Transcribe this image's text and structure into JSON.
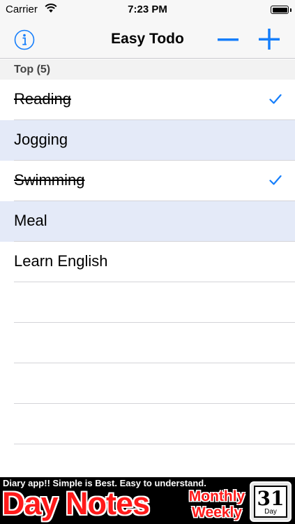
{
  "status_bar": {
    "carrier": "Carrier",
    "time": "7:23 PM"
  },
  "nav": {
    "title": "Easy Todo"
  },
  "section": {
    "header": "Top (5)"
  },
  "todos": [
    {
      "label": "Reading",
      "done": true,
      "checked": true,
      "highlighted": false
    },
    {
      "label": "Jogging",
      "done": false,
      "checked": false,
      "highlighted": true
    },
    {
      "label": "Swimming",
      "done": true,
      "checked": true,
      "highlighted": false
    },
    {
      "label": "Meal",
      "done": false,
      "checked": false,
      "highlighted": true
    },
    {
      "label": "Learn English",
      "done": false,
      "checked": false,
      "highlighted": false
    }
  ],
  "ad": {
    "tagline": "Diary app!! Simple is Best. Easy to understand.",
    "title": "Day Notes",
    "sub_line1": "Monthly",
    "sub_line2": "Weekly",
    "calendar_number": "31",
    "calendar_label": "Day"
  },
  "colors": {
    "accent": "#157efb",
    "highlight_row": "#e4eaf8",
    "ad_red": "#ff1a1a"
  }
}
